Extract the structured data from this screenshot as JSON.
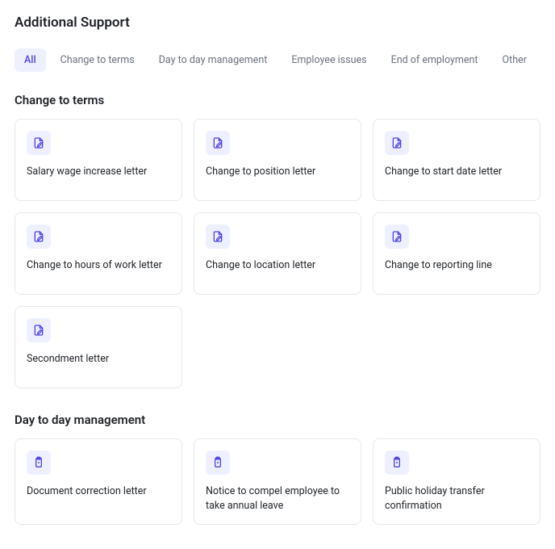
{
  "page_title": "Additional Support",
  "tabs": [
    {
      "label": "All",
      "active": true
    },
    {
      "label": "Change to terms",
      "active": false
    },
    {
      "label": "Day to day management",
      "active": false
    },
    {
      "label": "Employee issues",
      "active": false
    },
    {
      "label": "End of employment",
      "active": false
    },
    {
      "label": "Other",
      "active": false
    }
  ],
  "sections": [
    {
      "heading": "Change to terms",
      "icon": "document-edit-icon",
      "cards": [
        {
          "title": "Salary wage increase letter"
        },
        {
          "title": "Change to position letter"
        },
        {
          "title": "Change to start date letter"
        },
        {
          "title": "Change to hours of work letter"
        },
        {
          "title": "Change to location letter"
        },
        {
          "title": "Change to reporting line"
        },
        {
          "title": "Secondment letter"
        }
      ]
    },
    {
      "heading": "Day to day management",
      "icon": "clipboard-icon",
      "cards": [
        {
          "title": "Document correction letter"
        },
        {
          "title": "Notice to compel employee to take annual leave"
        },
        {
          "title": "Public holiday transfer confirmation"
        }
      ]
    }
  ]
}
